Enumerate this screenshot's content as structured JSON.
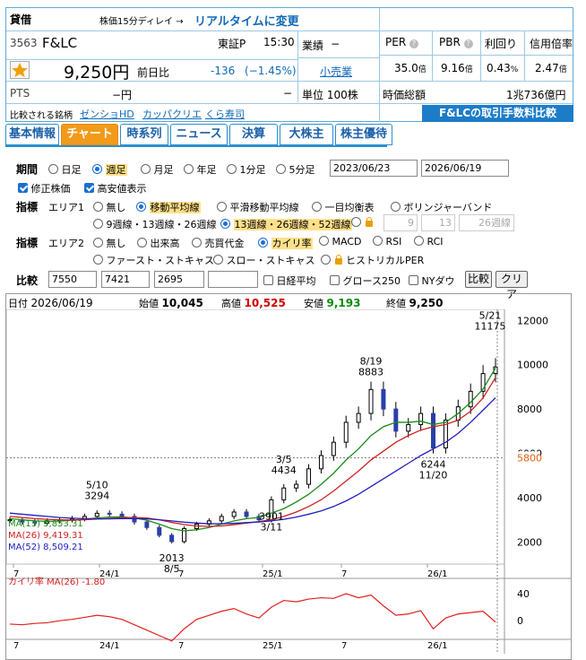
{
  "header": {
    "badge": "貸借",
    "delay_note": "株価15分ディレイ → ",
    "realtime_link": "リアルタイムに変更",
    "code": "3563",
    "name": "F&LC",
    "market": "東証P",
    "time": "15:30",
    "gyoseki_label": "業績",
    "gyoseki_value": "−",
    "sector_link": "小売業",
    "unit": "単位 100株",
    "price": "9,250円",
    "change_label": "前日比",
    "change": "-136",
    "change_pct": "(−1.45%)",
    "pts_label": "PTS",
    "pts_value": "−円",
    "pts_change": "−",
    "per_label": "PER",
    "pbr_label": "PBR",
    "yield_label": "利回り",
    "margin_label": "信用倍率",
    "per_value": "35.0",
    "per_unit": "倍",
    "pbr_value": "9.16",
    "pbr_unit": "倍",
    "yield_value": "0.43",
    "yield_unit": "%",
    "margin_value": "2.47",
    "margin_unit": "倍",
    "mcap_label": "時価総額",
    "mcap_value": "1兆736億円",
    "compare_label": "比較される銘柄",
    "compare_1": "ゼンショHD",
    "compare_2": "カッパクリエ",
    "compare_3": "くら寿司",
    "fee_banner": "F&LCの取引手数料比較"
  },
  "tabs": [
    "基本情報",
    "チャート",
    "時系列",
    "ニュース",
    "決算",
    "大株主",
    "株主優待"
  ],
  "controls": {
    "period_label": "期間",
    "periods": [
      "日足",
      "週足",
      "月足",
      "年足",
      "1分足",
      "5分足"
    ],
    "date_from": "2023/06/23",
    "date_to": "2026/06/19",
    "adj_label": "修正株価",
    "hl_label": "高安値表示",
    "ind_label": "指標",
    "area1": "エリア1",
    "area1_opts": [
      "無し",
      "移動平均線",
      "平滑移動平均線",
      "一目均衡表",
      "ボリンジャーバンド"
    ],
    "ma_opt1": "9週線・13週線・26週線",
    "ma_opt2": "13週線・26週線・52週線",
    "ma_in1": "9",
    "ma_in2": "13",
    "ma_in3": "26週線",
    "area2": "エリア2",
    "area2_opts": [
      "無し",
      "出来高",
      "売買代金",
      "カイリ率",
      "MACD",
      "RSI",
      "RCI"
    ],
    "area2_opts2": [
      "ファースト・ストキャス",
      "スロー・ストキャス",
      "ヒストリカルPER"
    ],
    "cmp_label": "比較",
    "cmp_in1": "7550",
    "cmp_in2": "7421",
    "cmp_in3": "2695",
    "cmp_in4": "",
    "nikkei": "日経平均",
    "growth": "グロース250",
    "nydow": "NYダウ",
    "cmp_btn": "比較",
    "clear_btn": "クリア"
  },
  "chart_data": {
    "type": "line",
    "info": {
      "date_label": "日付",
      "date": "2026/06/19",
      "open_label": "始値",
      "open": "10,045",
      "high_label": "高値",
      "high": "10,525",
      "low_label": "安値",
      "low": "9,193",
      "close_label": "終値",
      "close": "9,250"
    },
    "ylim": [
      1000,
      12500
    ],
    "y_ticks": [
      "12000",
      "10000",
      "8000",
      "6000",
      "4000",
      "2000"
    ],
    "y_tick_values": [
      12000,
      10000,
      8000,
      6000,
      4000,
      2000
    ],
    "highlight_level": 5800,
    "highlight_label": "5800",
    "x_ticks": [
      "7",
      "24/1",
      "7",
      "25/1",
      "7",
      "26/1"
    ],
    "x": [
      0,
      4,
      8,
      12,
      16,
      20,
      24,
      28,
      32,
      36,
      40,
      44,
      48,
      52,
      56,
      60,
      64,
      68,
      72,
      76,
      80,
      84,
      88,
      92,
      96,
      100,
      104,
      108,
      112,
      116,
      120,
      124,
      128,
      132,
      136,
      140,
      144,
      148,
      152,
      156
    ],
    "close": [
      3000,
      2900,
      2850,
      2950,
      3000,
      3050,
      3150,
      3294,
      3250,
      3150,
      2900,
      2650,
      2300,
      2013,
      2600,
      2800,
      2950,
      3150,
      3350,
      3150,
      3000,
      3901,
      4434,
      4600,
      5300,
      5900,
      6500,
      7400,
      7800,
      8883,
      8000,
      7000,
      7300,
      7800,
      6244,
      7500,
      8100,
      8800,
      9600,
      9900
    ],
    "peaks": [
      {
        "i": 7,
        "label": "5/10",
        "value": "3294"
      },
      {
        "i": 13,
        "label": "8/5",
        "value": "2013"
      },
      {
        "i": 22,
        "label": "3/5",
        "value": "4434"
      },
      {
        "i": 21,
        "label": "3/11",
        "value": "3901"
      },
      {
        "i": 29,
        "label": "8/19",
        "value": "8883"
      },
      {
        "i": 34,
        "label": "11/20",
        "value": "6244"
      }
    ],
    "last_peak": {
      "label": "5/21",
      "value": "11175"
    },
    "series": [
      {
        "name": "MA(13)",
        "label": "9,853.31",
        "color": "#1a8a1a",
        "values": [
          3050,
          3000,
          2950,
          2930,
          2940,
          2980,
          3030,
          3080,
          3120,
          3130,
          3080,
          2980,
          2800,
          2600,
          2500,
          2550,
          2650,
          2800,
          2950,
          3050,
          3100,
          3300,
          3500,
          3800,
          4150,
          4600,
          5100,
          5700,
          6200,
          6800,
          7200,
          7400,
          7400,
          7450,
          7300,
          7400,
          7800,
          8300,
          8900,
          9853
        ]
      },
      {
        "name": "MA(26)",
        "label": "9,419.31",
        "color": "#d02020",
        "values": [
          3150,
          3100,
          3050,
          3020,
          3000,
          2990,
          3000,
          3030,
          3060,
          3090,
          3100,
          3080,
          3000,
          2880,
          2780,
          2720,
          2700,
          2720,
          2780,
          2850,
          2920,
          3000,
          3150,
          3350,
          3600,
          3900,
          4300,
          4750,
          5200,
          5700,
          6100,
          6500,
          6800,
          7050,
          7200,
          7300,
          7500,
          7900,
          8500,
          9419
        ]
      },
      {
        "name": "MA(52)",
        "label": "8,509.21",
        "color": "#2020c0",
        "values": [
          3300,
          3250,
          3200,
          3150,
          3100,
          3070,
          3050,
          3040,
          3040,
          3050,
          3050,
          3040,
          3000,
          2950,
          2890,
          2850,
          2820,
          2820,
          2840,
          2870,
          2900,
          2950,
          3020,
          3120,
          3250,
          3400,
          3600,
          3850,
          4150,
          4500,
          4850,
          5200,
          5550,
          5900,
          6200,
          6500,
          6900,
          7400,
          7950,
          8509
        ]
      }
    ],
    "oscillator": {
      "name": "カイリ率 MA(26)",
      "value": "-1.80",
      "ylim": [
        -25,
        60
      ],
      "ticks": [
        "40",
        "0"
      ],
      "tick_values": [
        40,
        0
      ],
      "values": [
        -5,
        -6,
        -4,
        -3,
        0,
        2,
        5,
        8,
        6,
        2,
        -6,
        -14,
        -22,
        -30,
        -12,
        2,
        8,
        14,
        18,
        10,
        4,
        20,
        30,
        28,
        32,
        34,
        33,
        40,
        34,
        38,
        22,
        8,
        10,
        15,
        -12,
        4,
        10,
        12,
        14,
        -2
      ]
    }
  }
}
